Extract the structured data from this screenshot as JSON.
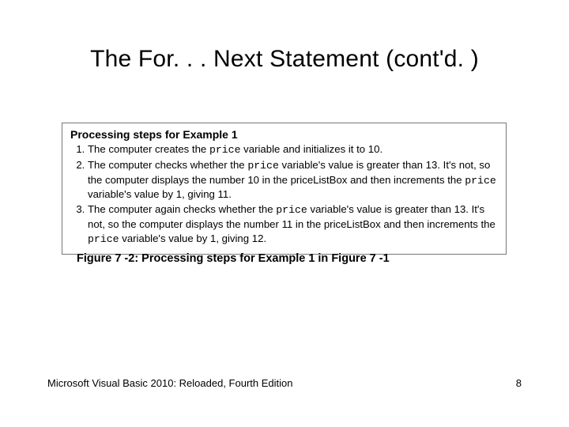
{
  "title": "The For. . . Next Statement (cont'd. )",
  "figure": {
    "heading": "Processing steps for Example 1",
    "steps": [
      {
        "pre1": "The computer creates the ",
        "code1": "price",
        "post1": " variable and initializes it to 10."
      },
      {
        "pre1": "The computer checks whether the ",
        "code1": "price",
        "mid1": " variable's value is greater than 13. It's not, so the computer displays the number 10 in the priceListBox and then increments the ",
        "code2": "price",
        "post2": " variable's value by 1, giving 11."
      },
      {
        "pre1": "The computer again checks whether the ",
        "code1": "price",
        "mid1": " variable's value is greater than 13. It's not, so the computer displays the number 11 in the priceListBox and then increments the ",
        "code2": "price",
        "post2": " variable's value by 1, giving 12."
      }
    ],
    "caption": "Figure 7 -2: Processing steps for Example 1 in Figure 7 -1"
  },
  "footer": {
    "left": "Microsoft Visual Basic 2010: Reloaded, Fourth Edition",
    "right": "8"
  }
}
